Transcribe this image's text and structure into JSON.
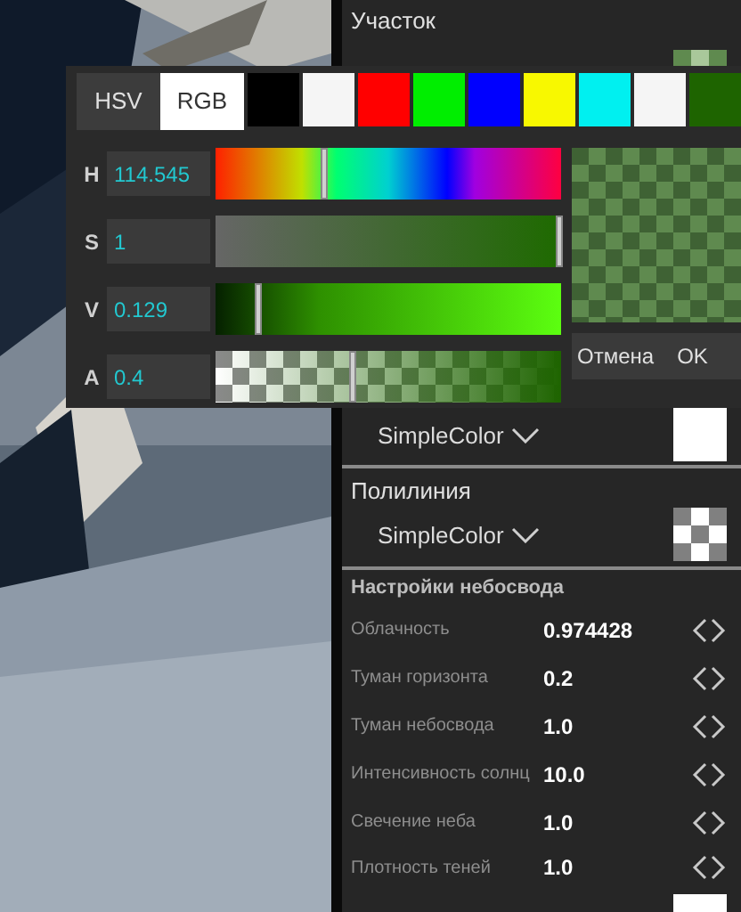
{
  "panel": {
    "section_title": "Участок",
    "color_fields": [
      {
        "kind": "tinted"
      },
      {
        "type_label": "SimpleColor",
        "kind": "solid"
      }
    ],
    "polyline": {
      "title": "Полилиния",
      "type_label": "SimpleColor",
      "kind": "transparent"
    },
    "sky_settings": {
      "title": "Настройки небосвода",
      "rows": [
        {
          "label": "Облачность",
          "value": "0.974428"
        },
        {
          "label": "Туман горизонта",
          "value": "0.2"
        },
        {
          "label": "Туман небосвода",
          "value": "1.0"
        },
        {
          "label": "Интенсивность солнц",
          "value": "10.0"
        },
        {
          "label": "Свечение неба",
          "value": "1.0"
        },
        {
          "label": "Плотность теней",
          "value": "1.0"
        }
      ]
    }
  },
  "color_picker": {
    "modes": [
      {
        "label": "HSV",
        "selected": false
      },
      {
        "label": "RGB",
        "selected": true
      }
    ],
    "swatches": [
      {
        "color": "#000000"
      },
      {
        "color": "#f5f5f5"
      },
      {
        "color": "#ff0000"
      },
      {
        "color": "#00ee00"
      },
      {
        "color": "#0000ff"
      },
      {
        "color": "#f8f800"
      },
      {
        "color": "#00f0f0"
      },
      {
        "color": "#f5f5f5"
      },
      {
        "color": "#1e6400"
      }
    ],
    "channels": [
      {
        "label": "H",
        "kind": "hue",
        "value": "114.545",
        "level": 0.32
      },
      {
        "label": "S",
        "kind": "saturation",
        "value": "1",
        "level": 1
      },
      {
        "label": "V",
        "kind": "value",
        "value": "0.129",
        "level": 0.13
      },
      {
        "label": "A",
        "kind": "alpha",
        "value": "0.4",
        "level": 0.4
      }
    ],
    "buttons": [
      "Отмена",
      "OK"
    ]
  }
}
